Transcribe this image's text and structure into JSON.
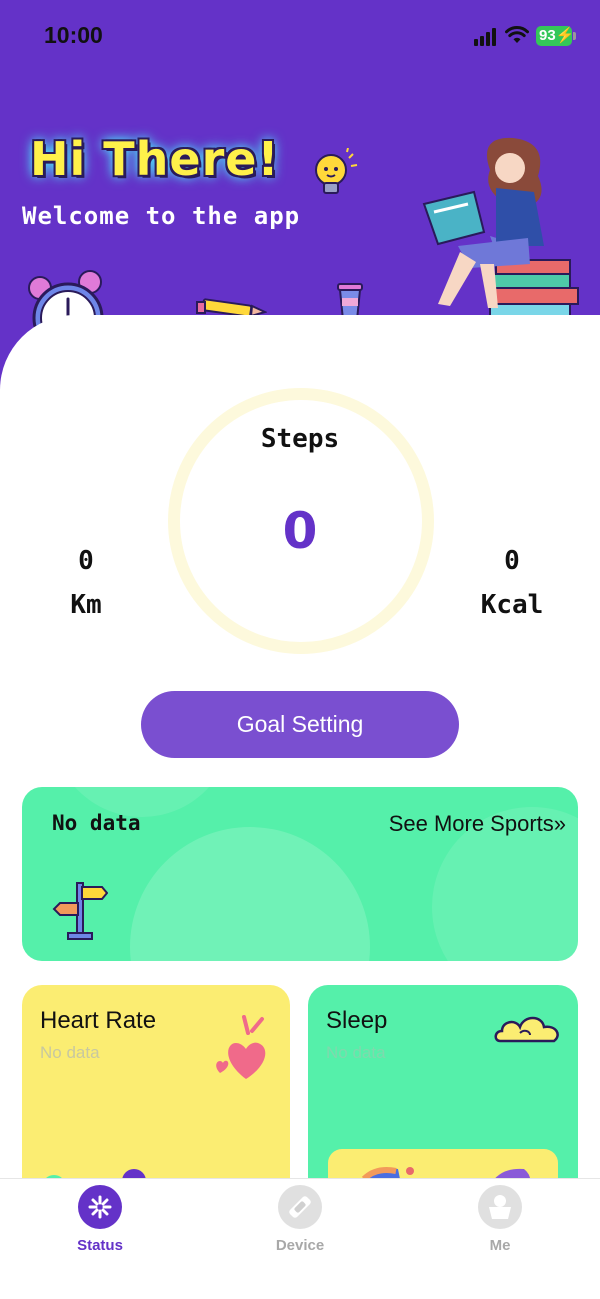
{
  "status_bar": {
    "time": "10:00",
    "battery": "93"
  },
  "header": {
    "greeting": "Hi There!",
    "welcome": "Welcome to the app"
  },
  "stats": {
    "steps_label": "Steps",
    "steps_value": "0",
    "distance_value": "0",
    "distance_unit": "Km",
    "calories_value": "0",
    "calories_unit": "Kcal"
  },
  "goal_button": "Goal Setting",
  "sports_card": {
    "status": "No data",
    "link": "See More Sports»"
  },
  "heart_rate_card": {
    "title": "Heart Rate",
    "subtitle": "No data"
  },
  "sleep_card": {
    "title": "Sleep",
    "subtitle": "No data"
  },
  "tabs": [
    {
      "label": "Status",
      "icon": "status-icon",
      "active": true
    },
    {
      "label": "Device",
      "icon": "device-icon",
      "active": false
    },
    {
      "label": "Me",
      "icon": "me-icon",
      "active": false
    }
  ],
  "colors": {
    "primary": "#6432c8",
    "mint": "#55f0aa",
    "yellow": "#fbed72",
    "ring": "#fdf9dc"
  }
}
